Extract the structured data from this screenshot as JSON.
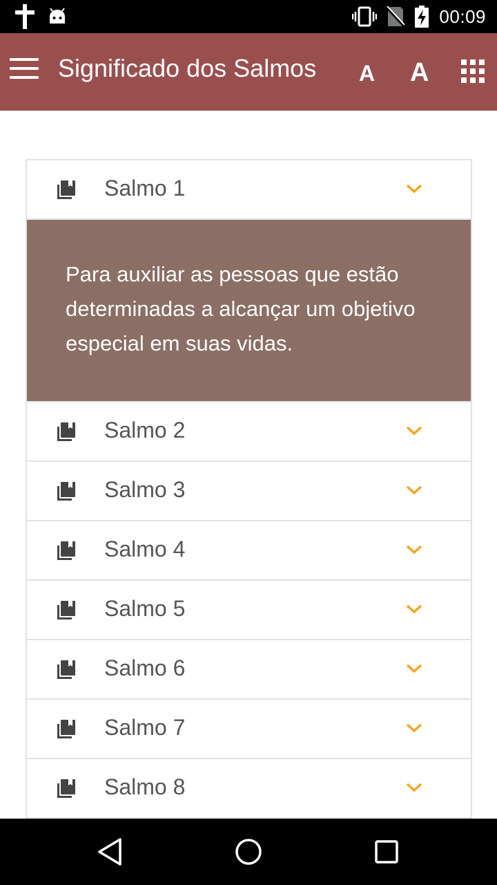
{
  "status_bar": {
    "time": "00:09",
    "icons": [
      "cross-icon",
      "android-icon",
      "vibrate-icon",
      "no-sim-icon",
      "battery-charging-icon"
    ]
  },
  "app_bar": {
    "title": "Significado dos Salmos",
    "font_small_label": "A",
    "font_large_label": "A",
    "menu_icon": "hamburger-menu-icon",
    "apps_icon": "grid-apps-icon",
    "background_color": "#9a4f4f"
  },
  "psalms": {
    "items": [
      {
        "label": "Salmo 1",
        "expanded": true
      },
      {
        "label": "Salmo 2",
        "expanded": false
      },
      {
        "label": "Salmo 3",
        "expanded": false
      },
      {
        "label": "Salmo 4",
        "expanded": false
      },
      {
        "label": "Salmo 5",
        "expanded": false
      },
      {
        "label": "Salmo 6",
        "expanded": false
      },
      {
        "label": "Salmo 7",
        "expanded": false
      },
      {
        "label": "Salmo 8",
        "expanded": false
      }
    ],
    "expanded_text": "Para auxiliar as pessoas que estão determinadas a alcançar um objetivo especial em suas vidas.",
    "panel_color": "#8b6e64",
    "chevron_color": "#f5a623"
  },
  "nav_bar": {
    "buttons": [
      "back-icon",
      "home-icon",
      "recents-icon"
    ]
  }
}
